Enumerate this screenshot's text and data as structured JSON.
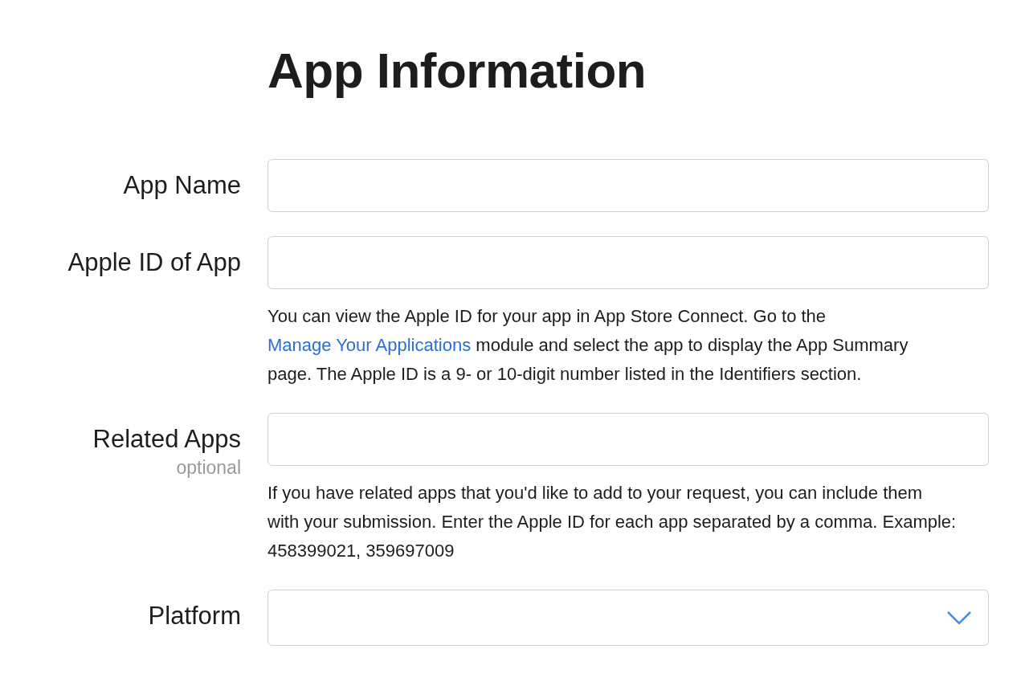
{
  "title": "App Information",
  "fields": [
    {
      "label": "App Name",
      "kind": "text"
    },
    {
      "label": "Apple ID of App",
      "kind": "text",
      "help": [
        {
          "text": "You can view the Apple ID for your app in App Store Connect. Go to the "
        },
        {
          "text": "Manage Your Applications",
          "kind": "link"
        },
        {
          "text": " module and select the app to display the App Summary page. The Apple ID is a 9- or 10-digit number listed in the Identifiers section."
        }
      ]
    },
    {
      "label": "Related Apps",
      "note": "optional",
      "kind": "text",
      "help": [
        {
          "text": "If you have related apps that you'd like to add to your request, you can include them with your submission. Enter the Apple ID for each app separated by a comma. Example: 458399021, 359697009"
        }
      ]
    },
    {
      "label": "Platform",
      "kind": "select"
    }
  ]
}
